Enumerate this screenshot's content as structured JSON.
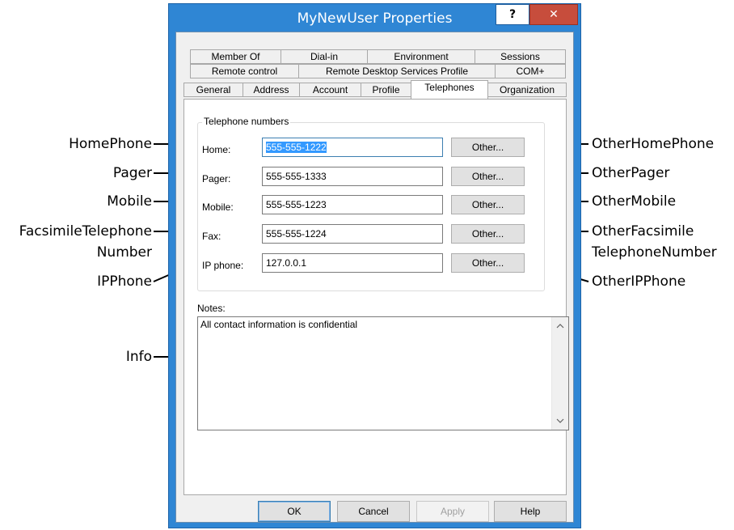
{
  "window": {
    "title": "MyNewUser Properties",
    "help_label": "?",
    "close_label": "✕",
    "accent_color": "#2f86d4"
  },
  "tabs": {
    "row1": [
      "Member Of",
      "Dial-in",
      "Environment",
      "Sessions"
    ],
    "row2": [
      "Remote control",
      "Remote Desktop Services Profile",
      "COM+"
    ],
    "row3": [
      "General",
      "Address",
      "Account",
      "Profile",
      "Telephones",
      "Organization"
    ],
    "active": "Telephones"
  },
  "telephone_group": {
    "title": "Telephone numbers",
    "fields": [
      {
        "label": "Home:",
        "value": "555-555-1222",
        "button": "Other..."
      },
      {
        "label": "Pager:",
        "value": "555-555-1333",
        "button": "Other..."
      },
      {
        "label": "Mobile:",
        "value": "555-555-1223",
        "button": "Other..."
      },
      {
        "label": "Fax:",
        "value": "555-555-1224",
        "button": "Other..."
      },
      {
        "label": "IP phone:",
        "value": "127.0.0.1",
        "button": "Other..."
      }
    ]
  },
  "notes": {
    "label": "Notes:",
    "value": "All contact information is confidential",
    "scroll_up_icon": "chevron-up-icon",
    "scroll_down_icon": "chevron-down-icon"
  },
  "buttons": {
    "ok": "OK",
    "cancel": "Cancel",
    "apply": "Apply",
    "help": "Help"
  },
  "callouts": {
    "home_phone": "HomePhone",
    "pager": "Pager",
    "mobile": "Mobile",
    "facsimile_1": "FacsimileTelephone",
    "facsimile_2": "Number",
    "ip_phone": "IPPhone",
    "info": "Info",
    "other_home_phone": "OtherHomePhone",
    "other_pager": "OtherPager",
    "other_mobile": "OtherMobile",
    "other_facsimile_1": "OtherFacsimile",
    "other_facsimile_2": "TelephoneNumber",
    "other_ip_phone": "OtherIPPhone"
  }
}
